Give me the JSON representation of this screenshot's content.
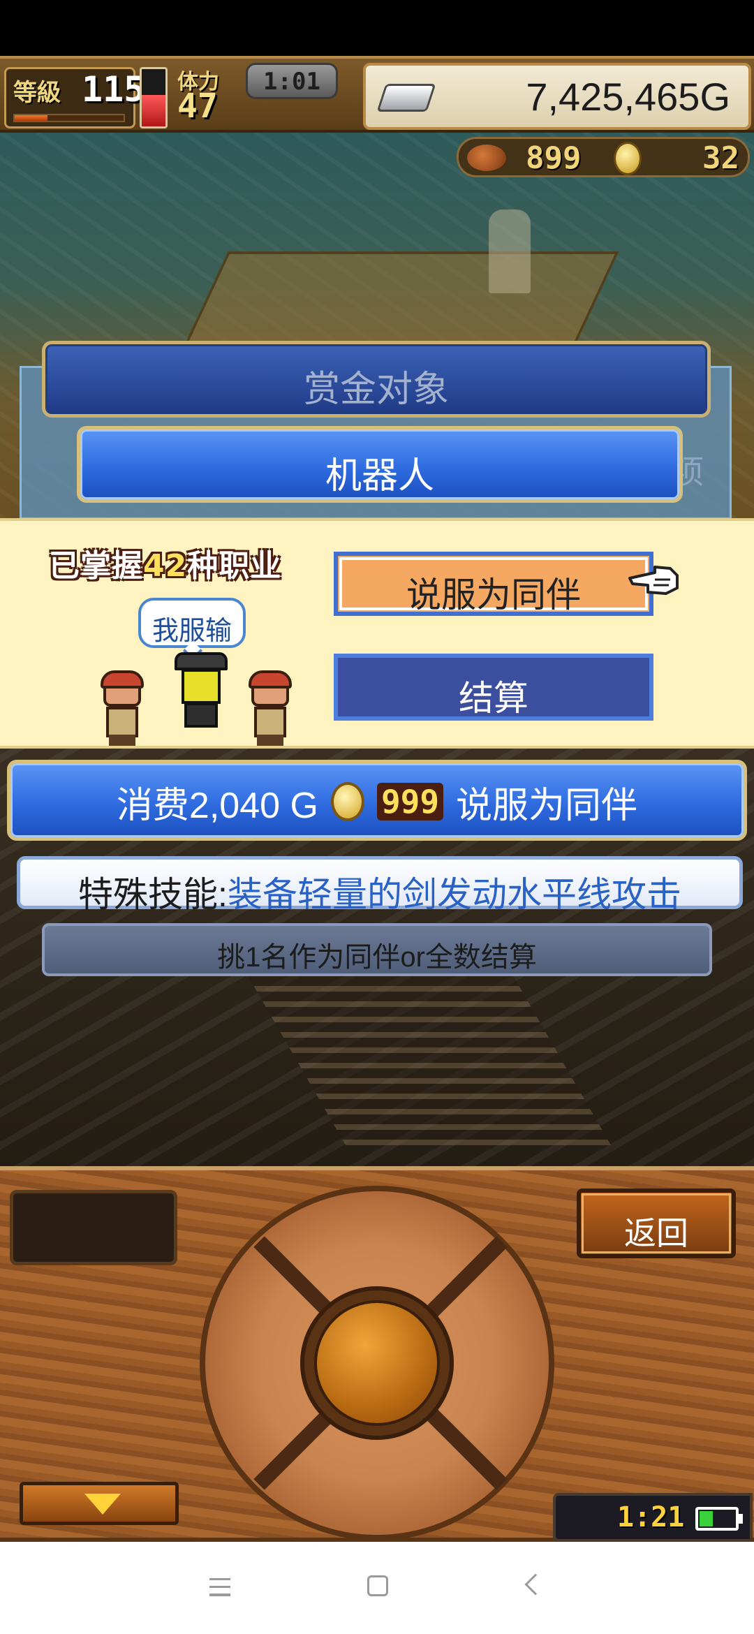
{
  "hud": {
    "level_label": "等級",
    "level_value": "115",
    "level_progress": 0.3,
    "stamina_label": "体力",
    "stamina_value": "47",
    "stamina_level": 0.55,
    "clock": "1:01",
    "gold": "7,425,465G",
    "icons": {
      "money": "silver-ingot-icon",
      "food": "meat-icon",
      "coin": "gold-coin-icon"
    }
  },
  "resources": {
    "food": "899",
    "coins": "32"
  },
  "bounty": {
    "title": "赏金对象",
    "target": "机器人",
    "hint_fragment": "项"
  },
  "recruit": {
    "jobs_prefix": "已掌握",
    "jobs_count": "42",
    "jobs_suffix": "种职业",
    "speech": "我服输",
    "persuade_label": "说服为同伴",
    "settle_label": "结算"
  },
  "cost": {
    "text": "消费2,040 G",
    "coin_count": "999",
    "action": "说服为同伴"
  },
  "skill": {
    "label": "特殊技能:",
    "text": "装备轻量的剑发动水平线攻击"
  },
  "hint": "挑1名作为同伴or全数结算",
  "controller": {
    "back_label": "返回",
    "mini_clock": "1:21",
    "battery_level": 0.35
  },
  "colors": {
    "ribbon_blue": "#2f6ce0",
    "panel_cream": "#fff3c2",
    "persuade_orange": "#f4a862",
    "settle_navy": "#3c4f9e",
    "skill_blue": "#2a61c4",
    "wood": "#9a5a28"
  }
}
